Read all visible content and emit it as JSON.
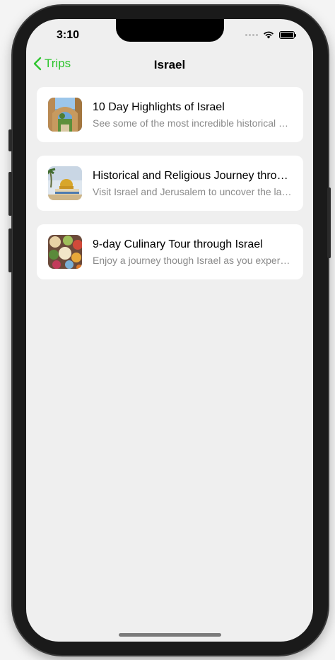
{
  "status_bar": {
    "time": "3:10"
  },
  "nav": {
    "back_label": "Trips",
    "title": "Israel",
    "accent_color": "#2dc52d"
  },
  "trips": [
    {
      "title": "10 Day Highlights of Israel",
      "subtitle": "See some of the most incredible historical sites in Israel",
      "image": "old-city-arch-photo"
    },
    {
      "title": "Historical and Religious Journey through Israel",
      "subtitle": "Visit Israel and Jerusalem to uncover the layers of history",
      "image": "dome-of-the-rock-photo"
    },
    {
      "title": "9-day Culinary Tour through Israel",
      "subtitle": "Enjoy a journey though Israel as you experience its cuisine",
      "image": "food-platter-photo"
    }
  ]
}
